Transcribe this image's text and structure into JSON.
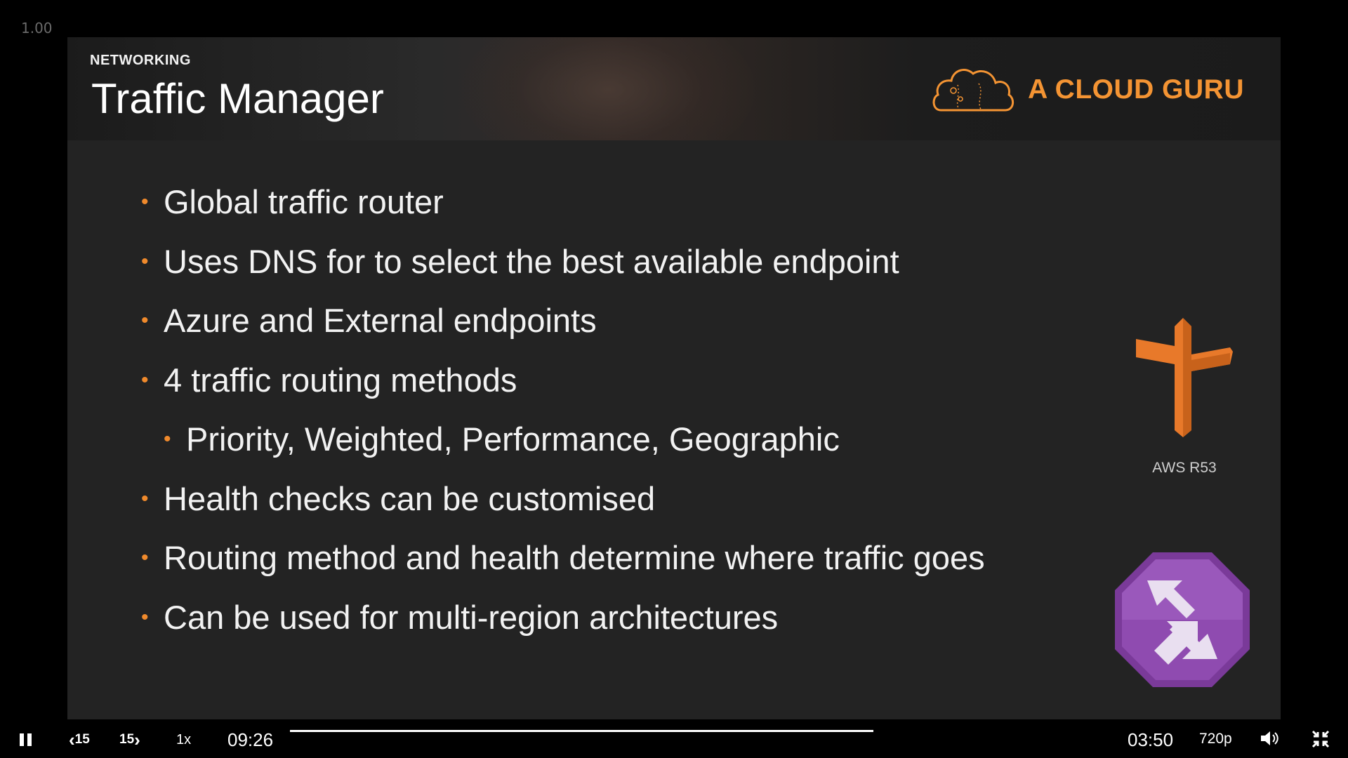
{
  "zoom_indicator": "1.00",
  "slide": {
    "section_label": "NETWORKING",
    "title": "Traffic Manager",
    "brand_name": "A CLOUD GURU",
    "brand_color": "#f49433",
    "bullets": [
      {
        "text": "Global traffic router",
        "level": 1
      },
      {
        "text": "Uses DNS for to select the best available endpoint",
        "level": 1
      },
      {
        "text": "Azure and External endpoints",
        "level": 1
      },
      {
        "text": "4 traffic routing methods",
        "level": 1
      },
      {
        "text": "Priority, Weighted, Performance, Geographic",
        "level": 2
      },
      {
        "text": "Health checks can be customised",
        "level": 1
      },
      {
        "text": "Routing method and health determine where traffic goes",
        "level": 1
      },
      {
        "text": "Can be used for multi-region architectures",
        "level": 1
      }
    ],
    "bullet_glyph": "•",
    "bullet_color": "#f08a2c",
    "aws_label": "AWS R53",
    "aws_icon": "route53-signpost-icon",
    "azure_icon": "traffic-manager-icon"
  },
  "player": {
    "play_state_icon": "pause-icon",
    "rewind_label": "15",
    "forward_label": "15",
    "speed_label": "1x",
    "time_current": "09:26",
    "time_remaining": "03:50",
    "quality_label": "720p",
    "volume_icon": "volume-icon",
    "fullscreen_icon": "exit-fullscreen-icon"
  }
}
